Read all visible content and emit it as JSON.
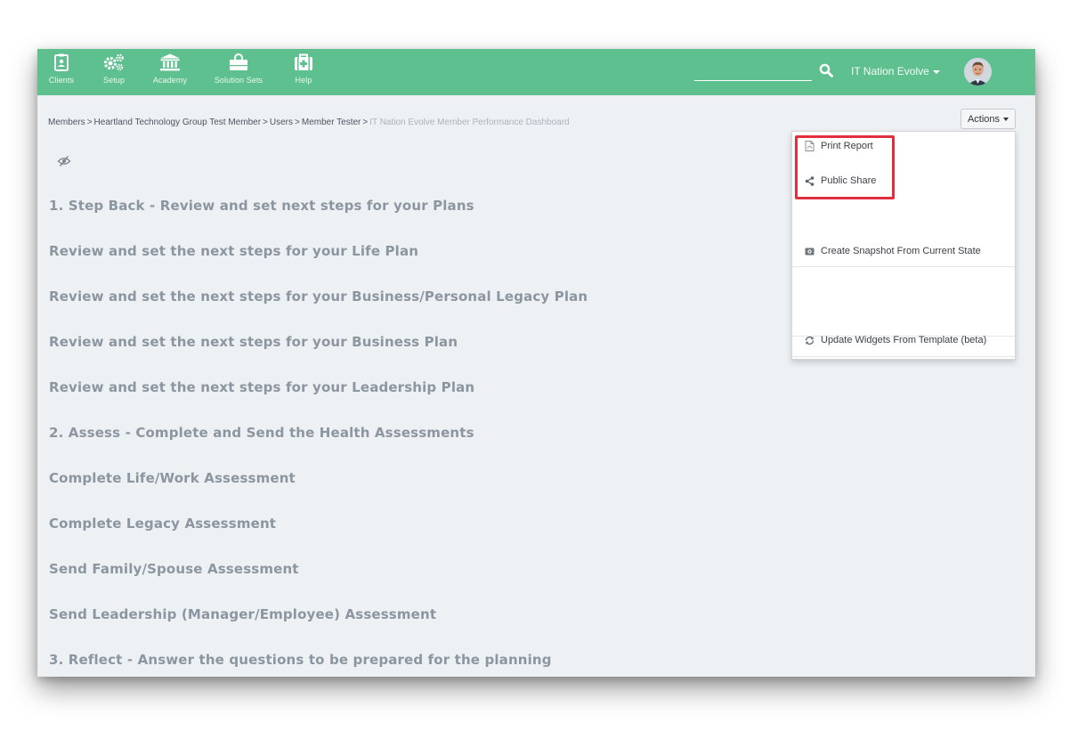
{
  "nav": {
    "items": [
      {
        "label": "Clients",
        "icon": "clipboard-user-icon"
      },
      {
        "label": "Setup",
        "icon": "gears-icon"
      },
      {
        "label": "Academy",
        "icon": "bank-icon"
      },
      {
        "label": "Solution Sets",
        "icon": "shopping-bag-icon"
      },
      {
        "label": "Help",
        "icon": "medkit-icon"
      }
    ],
    "search_placeholder": "",
    "account_name": "IT Nation Evolve"
  },
  "breadcrumb": {
    "items": [
      "Members",
      "Heartland Technology Group Test Member",
      "Users",
      "Member Tester"
    ],
    "separator": ">",
    "current": "IT Nation Evolve Member Performance Dashboard"
  },
  "actions_label": "Actions",
  "actions_menu": {
    "items": [
      {
        "label": "Print Report",
        "icon": "file-pdf-icon"
      },
      {
        "label": "Public Share",
        "icon": "share-icon"
      },
      {
        "label": "Create Snapshot From Current State",
        "icon": "camera-icon"
      },
      {
        "label": "Update Widgets From Template (beta)",
        "icon": "refresh-icon"
      }
    ]
  },
  "headings": [
    "1. Step Back - Review and set next steps for your Plans",
    "Review and set the next steps for your Life Plan",
    "Review and set the next steps for your Business/Personal Legacy Plan",
    "Review and set the next steps for your Business Plan",
    "Review and set the next steps for your Leadership Plan",
    "2. Assess - Complete and Send the Health Assessments",
    "Complete Life/Work Assessment",
    "Complete Legacy Assessment",
    "Send Family/Spouse Assessment",
    "Send Leadership (Manager/Employee) Assessment",
    "3. Reflect - Answer the questions to be prepared for the planning"
  ],
  "colors": {
    "topbar": "#5fc08f",
    "page_bg": "#eef1f4",
    "heading_text": "#8c96a0",
    "highlight": "#e03040"
  }
}
